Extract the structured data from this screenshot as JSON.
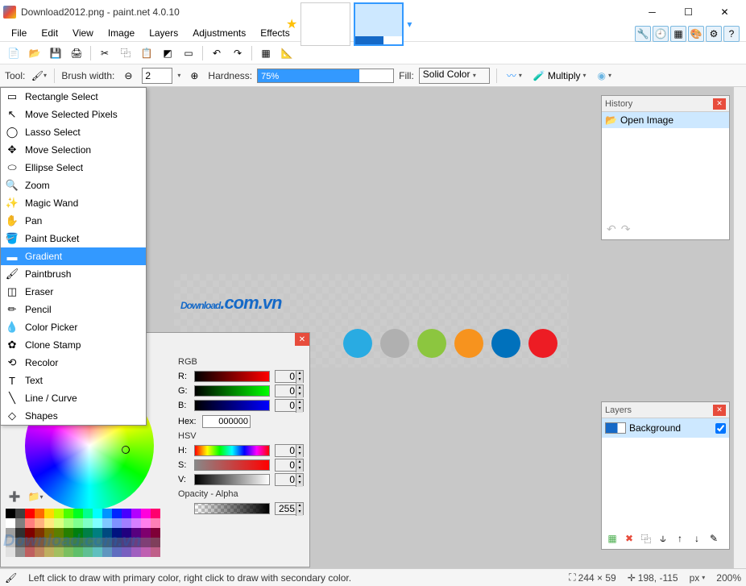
{
  "titlebar": {
    "title": "Download2012.png - paint.net 4.0.10"
  },
  "menu": [
    "File",
    "Edit",
    "View",
    "Image",
    "Layers",
    "Adjustments",
    "Effects"
  ],
  "toolbar_icons": [
    "new",
    "open",
    "save",
    "print",
    "cut",
    "copy",
    "paste",
    "crop",
    "deselect",
    "undo",
    "redo",
    "grid",
    "ruler"
  ],
  "right_icons": [
    {
      "name": "tools-window-icon",
      "glyph": "🔧"
    },
    {
      "name": "history-window-icon",
      "glyph": "🕘"
    },
    {
      "name": "layers-window-icon",
      "glyph": "▦"
    },
    {
      "name": "colors-window-icon",
      "glyph": "🎨"
    },
    {
      "name": "settings-icon",
      "glyph": "⚙"
    },
    {
      "name": "help-icon",
      "glyph": "?"
    }
  ],
  "tool_opts": {
    "tool_label": "Tool:",
    "brush_label": "Brush width:",
    "brush_value": "2",
    "hardness_label": "Hardness:",
    "hardness_value": "75%",
    "fill_label": "Fill:",
    "fill_value": "Solid Color",
    "blend_label": "Multiply"
  },
  "tool_dropdown": [
    {
      "icon": "▭",
      "label": "Rectangle Select"
    },
    {
      "icon": "↖",
      "label": "Move Selected Pixels"
    },
    {
      "icon": "◯",
      "label": "Lasso Select"
    },
    {
      "icon": "✥",
      "label": "Move Selection"
    },
    {
      "icon": "⬭",
      "label": "Ellipse Select"
    },
    {
      "icon": "🔍",
      "label": "Zoom"
    },
    {
      "icon": "✨",
      "label": "Magic Wand"
    },
    {
      "icon": "✋",
      "label": "Pan"
    },
    {
      "icon": "🪣",
      "label": "Paint Bucket"
    },
    {
      "icon": "▬",
      "label": "Gradient",
      "selected": true
    },
    {
      "icon": "🖌",
      "label": "Paintbrush"
    },
    {
      "icon": "◫",
      "label": "Eraser"
    },
    {
      "icon": "✏",
      "label": "Pencil"
    },
    {
      "icon": "💧",
      "label": "Color Picker"
    },
    {
      "icon": "✿",
      "label": "Clone Stamp"
    },
    {
      "icon": "⟲",
      "label": "Recolor"
    },
    {
      "icon": "T",
      "label": "Text"
    },
    {
      "icon": "╲",
      "label": "Line / Curve"
    },
    {
      "icon": "◇",
      "label": "Shapes"
    }
  ],
  "canvas": {
    "text_main": "Download",
    "text_sub": ".com.vn",
    "circle_colors": [
      "#29abe2",
      "#b0b0b0",
      "#8cc63f",
      "#f7931e",
      "#0071bc",
      "#ed1c24"
    ]
  },
  "history": {
    "title": "History",
    "items": [
      "Open Image"
    ]
  },
  "layers": {
    "title": "Layers",
    "items": [
      {
        "name": "Background",
        "visible": true
      }
    ]
  },
  "colors": {
    "rgb_label": "RGB",
    "hsv_label": "HSV",
    "channels": {
      "R": "0",
      "G": "0",
      "B": "0",
      "H": "0",
      "S": "0",
      "V": "0"
    },
    "hex_label": "Hex:",
    "hex_value": "000000",
    "opacity_label": "Opacity - Alpha",
    "opacity_value": "255"
  },
  "palette_colors": [
    "#000000",
    "#404040",
    "#ff0000",
    "#ff6a00",
    "#ffd800",
    "#b6ff00",
    "#4cff00",
    "#00ff21",
    "#00ff90",
    "#00ffff",
    "#0094ff",
    "#0026ff",
    "#4800ff",
    "#b200ff",
    "#ff00dc",
    "#ff006e",
    "#ffffff",
    "#808080",
    "#ff7f7f",
    "#ffb27f",
    "#ffe97f",
    "#daff7f",
    "#a5ff7f",
    "#7fff8e",
    "#7fffc5",
    "#7fffff",
    "#7fc9ff",
    "#7f92ff",
    "#a17fff",
    "#d67fff",
    "#ff7fed",
    "#ff7fb6",
    "#a0a0a0",
    "#303030",
    "#7f0000",
    "#7f3300",
    "#7f6a00",
    "#5b7f00",
    "#267f00",
    "#007f0e",
    "#007f46",
    "#007f7f",
    "#004a7f",
    "#00137f",
    "#21007f",
    "#57007f",
    "#7f006e",
    "#7f0037",
    "#c0c0c0",
    "#606060",
    "#7f3f3f",
    "#7f593f",
    "#7f743f",
    "#6d7f3f",
    "#527f3f",
    "#3f7f47",
    "#3f7f62",
    "#3f7f7f",
    "#3f647f",
    "#3f497f",
    "#503f7f",
    "#6b3f7f",
    "#7f3f76",
    "#7f3f5b",
    "#e0e0e0",
    "#909090",
    "#bf5f5f",
    "#bf855f",
    "#bfae5f",
    "#a3bf5f",
    "#7bbf5f",
    "#5fbf6a",
    "#5fbf93",
    "#5fbfbf",
    "#5f96bf",
    "#5f6dbf",
    "#785fbf",
    "#a05fbf",
    "#bf5fb1",
    "#bf5f88"
  ],
  "watermark": "Download.com.vn",
  "status": {
    "hint": "Left click to draw with primary color, right click to draw with secondary color.",
    "dims": "244 × 59",
    "coords": "198, -115",
    "unit": "px",
    "zoom": "200%"
  }
}
